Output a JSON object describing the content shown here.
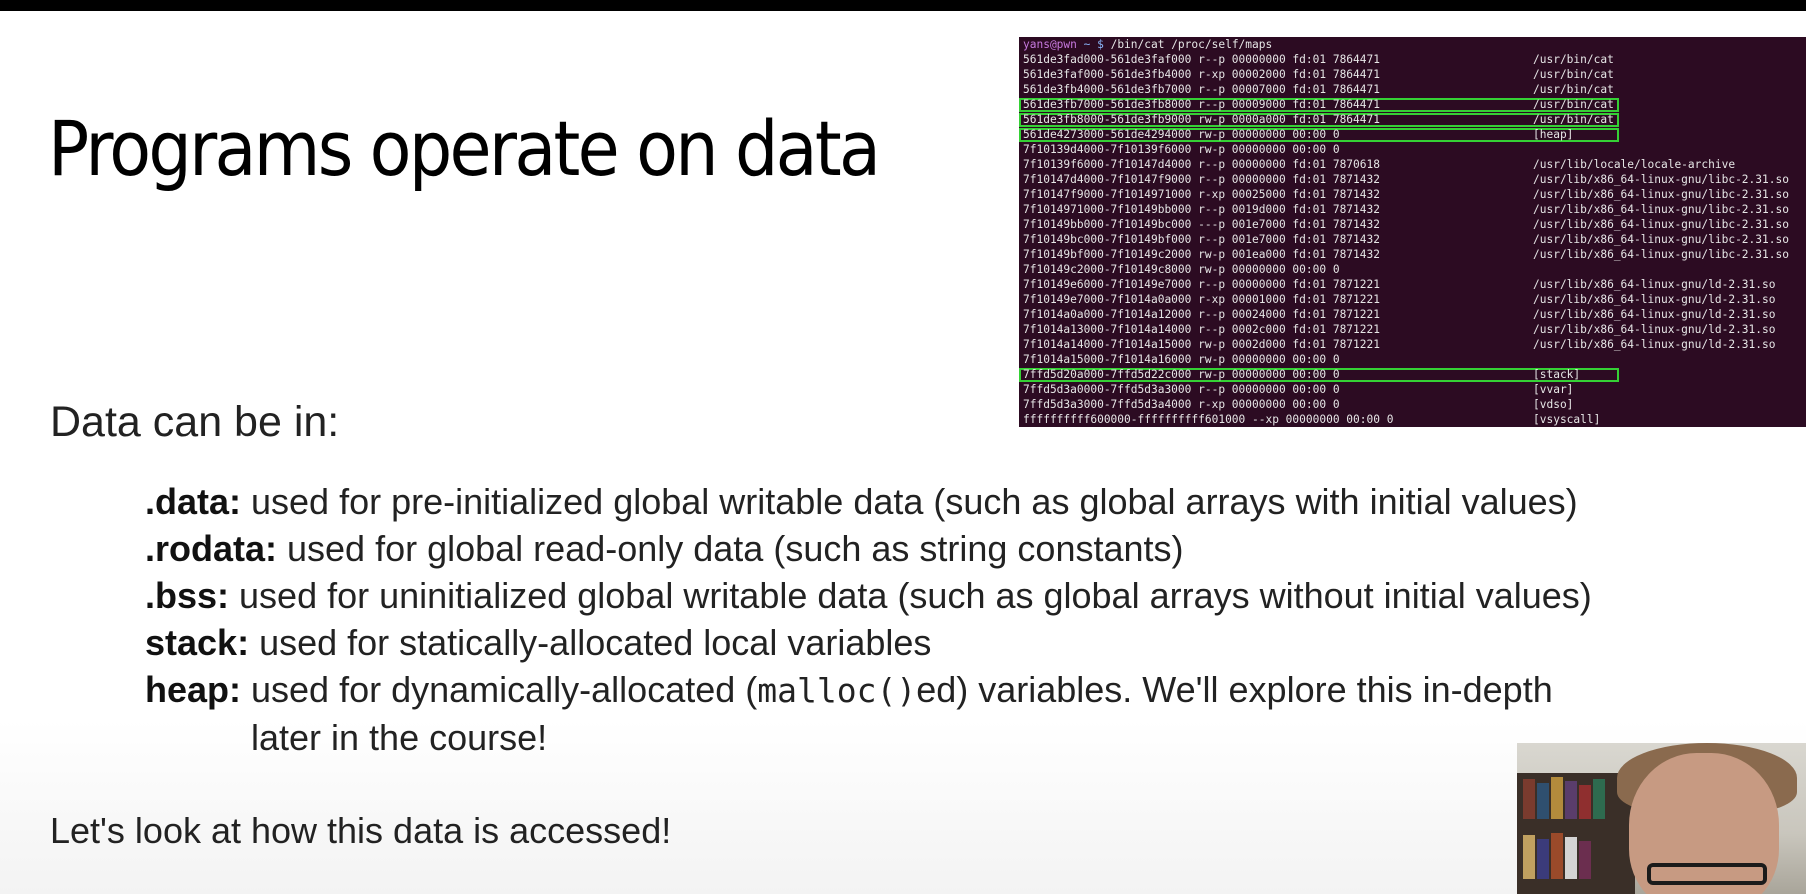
{
  "slide": {
    "title": "Programs operate on data",
    "intro": "Data can be in:",
    "items": [
      {
        "term": ".data:",
        "text": " used for pre-initialized global writable data (such as global arrays with initial values)"
      },
      {
        "term": ".rodata:",
        "text": " used for global read-only data (such as string constants)"
      },
      {
        "term": ".bss:",
        "text": " used for uninitialized global writable data (such as global arrays without initial values)"
      },
      {
        "term": "stack:",
        "text": " used for statically-allocated local variables"
      },
      {
        "term": "heap:",
        "text_before": " used for dynamically-allocated (",
        "code": "malloc()",
        "text_after": "ed) variables. We'll explore this in-depth",
        "continuation": "later in the course!"
      }
    ],
    "closing": "Let's look at how this data is accessed!"
  },
  "terminal": {
    "prompt_user": "yans@pwn",
    "prompt_path": " ~ $",
    "command": " /bin/cat /proc/self/maps",
    "highlight_color": "#35d035",
    "lines": [
      {
        "text": "561de3fad000-561de3faf000 r--p 00000000 fd:01 7864471",
        "path": "/usr/bin/cat",
        "highlight": false
      },
      {
        "text": "561de3faf000-561de3fb4000 r-xp 00002000 fd:01 7864471",
        "path": "/usr/bin/cat",
        "highlight": false
      },
      {
        "text": "561de3fb4000-561de3fb7000 r--p 00007000 fd:01 7864471",
        "path": "/usr/bin/cat",
        "highlight": false
      },
      {
        "text": "561de3fb7000-561de3fb8000 r--p 00009000 fd:01 7864471",
        "path": "/usr/bin/cat",
        "highlight": true
      },
      {
        "text": "561de3fb8000-561de3fb9000 rw-p 0000a000 fd:01 7864471",
        "path": "/usr/bin/cat",
        "highlight": true
      },
      {
        "text": "561de4273000-561de4294000 rw-p 00000000 00:00 0",
        "path": "[heap]",
        "highlight": true
      },
      {
        "text": "7f10139d4000-7f10139f6000 rw-p 00000000 00:00 0",
        "path": "",
        "highlight": false
      },
      {
        "text": "7f10139f6000-7f10147d4000 r--p 00000000 fd:01 7870618",
        "path": "/usr/lib/locale/locale-archive",
        "highlight": false
      },
      {
        "text": "7f10147d4000-7f10147f9000 r--p 00000000 fd:01 7871432",
        "path": "/usr/lib/x86_64-linux-gnu/libc-2.31.so",
        "highlight": false
      },
      {
        "text": "7f10147f9000-7f1014971000 r-xp 00025000 fd:01 7871432",
        "path": "/usr/lib/x86_64-linux-gnu/libc-2.31.so",
        "highlight": false
      },
      {
        "text": "7f1014971000-7f10149bb000 r--p 0019d000 fd:01 7871432",
        "path": "/usr/lib/x86_64-linux-gnu/libc-2.31.so",
        "highlight": false
      },
      {
        "text": "7f10149bb000-7f10149bc000 ---p 001e7000 fd:01 7871432",
        "path": "/usr/lib/x86_64-linux-gnu/libc-2.31.so",
        "highlight": false
      },
      {
        "text": "7f10149bc000-7f10149bf000 r--p 001e7000 fd:01 7871432",
        "path": "/usr/lib/x86_64-linux-gnu/libc-2.31.so",
        "highlight": false
      },
      {
        "text": "7f10149bf000-7f10149c2000 rw-p 001ea000 fd:01 7871432",
        "path": "/usr/lib/x86_64-linux-gnu/libc-2.31.so",
        "highlight": false
      },
      {
        "text": "7f10149c2000-7f10149c8000 rw-p 00000000 00:00 0",
        "path": "",
        "highlight": false
      },
      {
        "text": "7f10149e6000-7f10149e7000 r--p 00000000 fd:01 7871221",
        "path": "/usr/lib/x86_64-linux-gnu/ld-2.31.so",
        "highlight": false
      },
      {
        "text": "7f10149e7000-7f1014a0a000 r-xp 00001000 fd:01 7871221",
        "path": "/usr/lib/x86_64-linux-gnu/ld-2.31.so",
        "highlight": false
      },
      {
        "text": "7f1014a0a000-7f1014a12000 r--p 00024000 fd:01 7871221",
        "path": "/usr/lib/x86_64-linux-gnu/ld-2.31.so",
        "highlight": false
      },
      {
        "text": "7f1014a13000-7f1014a14000 r--p 0002c000 fd:01 7871221",
        "path": "/usr/lib/x86_64-linux-gnu/ld-2.31.so",
        "highlight": false
      },
      {
        "text": "7f1014a14000-7f1014a15000 rw-p 0002d000 fd:01 7871221",
        "path": "/usr/lib/x86_64-linux-gnu/ld-2.31.so",
        "highlight": false
      },
      {
        "text": "7f1014a15000-7f1014a16000 rw-p 00000000 00:00 0",
        "path": "",
        "highlight": false
      },
      {
        "text": "7ffd5d20a000-7ffd5d22c000 rw-p 00000000 00:00 0",
        "path": "[stack]",
        "highlight": true
      },
      {
        "text": "7ffd5d3a0000-7ffd5d3a3000 r--p 00000000 00:00 0",
        "path": "[vvar]",
        "highlight": false
      },
      {
        "text": "7ffd5d3a3000-7ffd5d3a4000 r-xp 00000000 00:00 0",
        "path": "[vdso]",
        "highlight": false
      },
      {
        "text": "ffffffffff600000-ffffffffff601000 --xp 00000000 00:00 0",
        "path": "[vsyscall]",
        "highlight": false
      }
    ]
  },
  "webcam": {
    "icon": "presenter-webcam"
  }
}
